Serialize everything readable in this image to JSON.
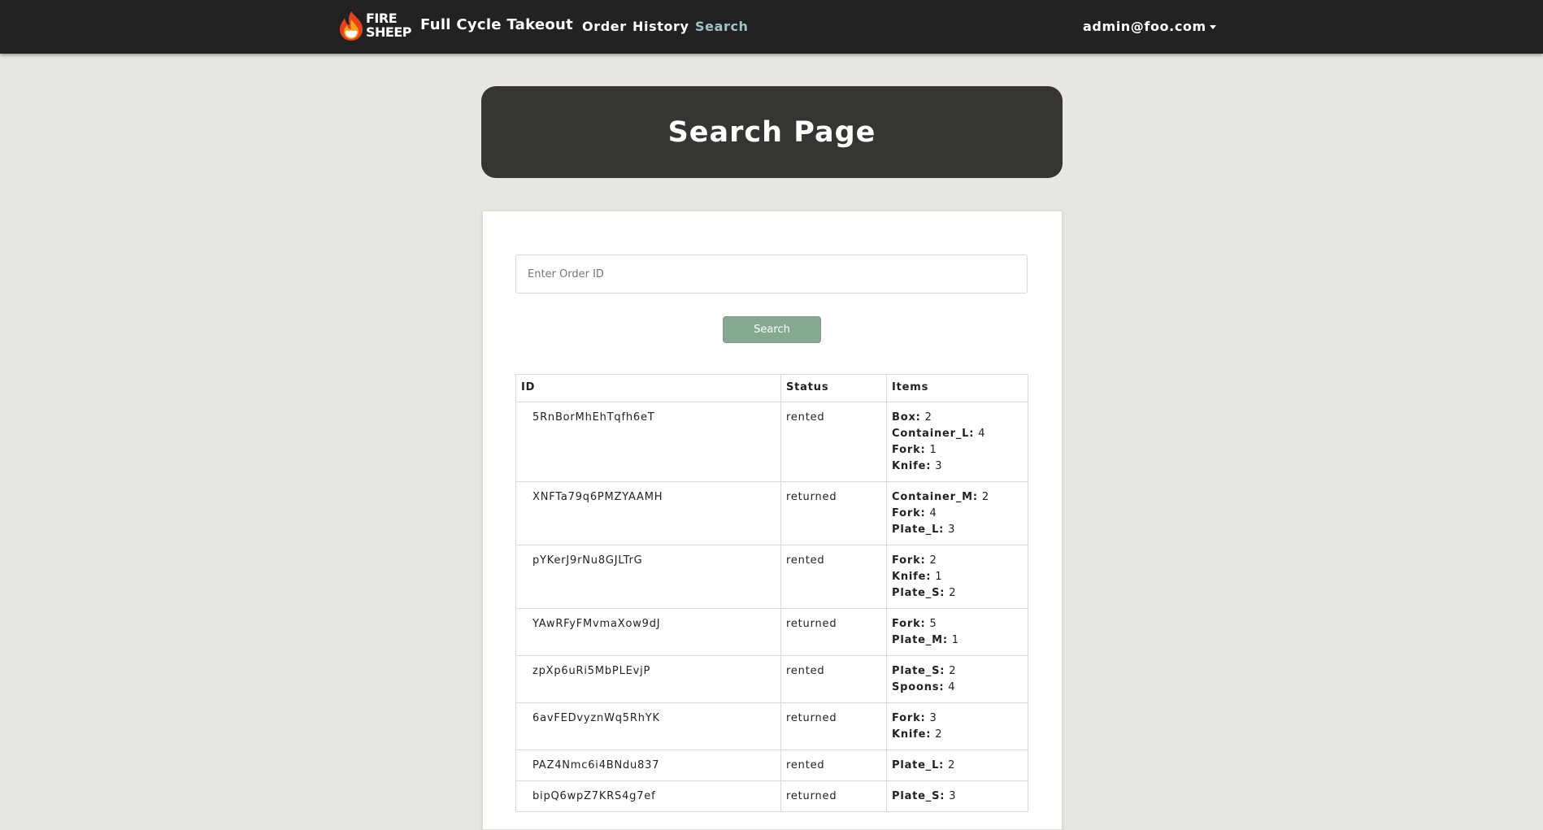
{
  "navbar": {
    "logo_text_top": "FIRE",
    "logo_text_bottom": "SHEEP",
    "brand": "Full Cycle Takeout",
    "links": [
      "Order",
      "History",
      "Search"
    ],
    "active_link": "Search",
    "user": "admin@foo.com",
    "active_color": "#9ec3c9"
  },
  "header": {
    "title": "Search Page"
  },
  "search": {
    "placeholder": "Enter Order ID",
    "value": "",
    "button_label": "Search"
  },
  "table": {
    "columns": [
      "ID",
      "Status",
      "Items"
    ],
    "rows": [
      {
        "id": "5RnBorMhEhTqfh6eT",
        "status": "rented",
        "items": [
          [
            "Box:",
            "2"
          ],
          [
            "Container_L:",
            "4"
          ],
          [
            "Fork:",
            "1"
          ],
          [
            "Knife:",
            "3"
          ]
        ]
      },
      {
        "id": "XNFTa79q6PMZYAAMH",
        "status": "returned",
        "items": [
          [
            "Container_M:",
            "2"
          ],
          [
            "Fork:",
            "4"
          ],
          [
            "Plate_L:",
            "3"
          ]
        ]
      },
      {
        "id": "pYKerJ9rNu8GJLTrG",
        "status": "rented",
        "items": [
          [
            "Fork:",
            "2"
          ],
          [
            "Knife:",
            "1"
          ],
          [
            "Plate_S:",
            "2"
          ]
        ]
      },
      {
        "id": "YAwRFyFMvmaXow9dJ",
        "status": "returned",
        "items": [
          [
            "Fork:",
            "5"
          ],
          [
            "Plate_M:",
            "1"
          ]
        ]
      },
      {
        "id": "zpXp6uRi5MbPLEvjP",
        "status": "rented",
        "items": [
          [
            "Plate_S:",
            "2"
          ],
          [
            "Spoons:",
            "4"
          ]
        ]
      },
      {
        "id": "6avFEDvyznWq5RhYK",
        "status": "returned",
        "items": [
          [
            "Fork:",
            "3"
          ],
          [
            "Knife:",
            "2"
          ]
        ]
      },
      {
        "id": "PAZ4Nmc6i4BNdu837",
        "status": "rented",
        "items": [
          [
            "Plate_L:",
            "2"
          ]
        ]
      },
      {
        "id": "bipQ6wpZ7KRS4g7ef",
        "status": "returned",
        "items": [
          [
            "Plate_S:",
            "3"
          ]
        ]
      }
    ]
  },
  "colors": {
    "navbar": "#222222",
    "page_background": "#e7e7e2",
    "banner": "#363531",
    "search_button": "#86a98f"
  }
}
